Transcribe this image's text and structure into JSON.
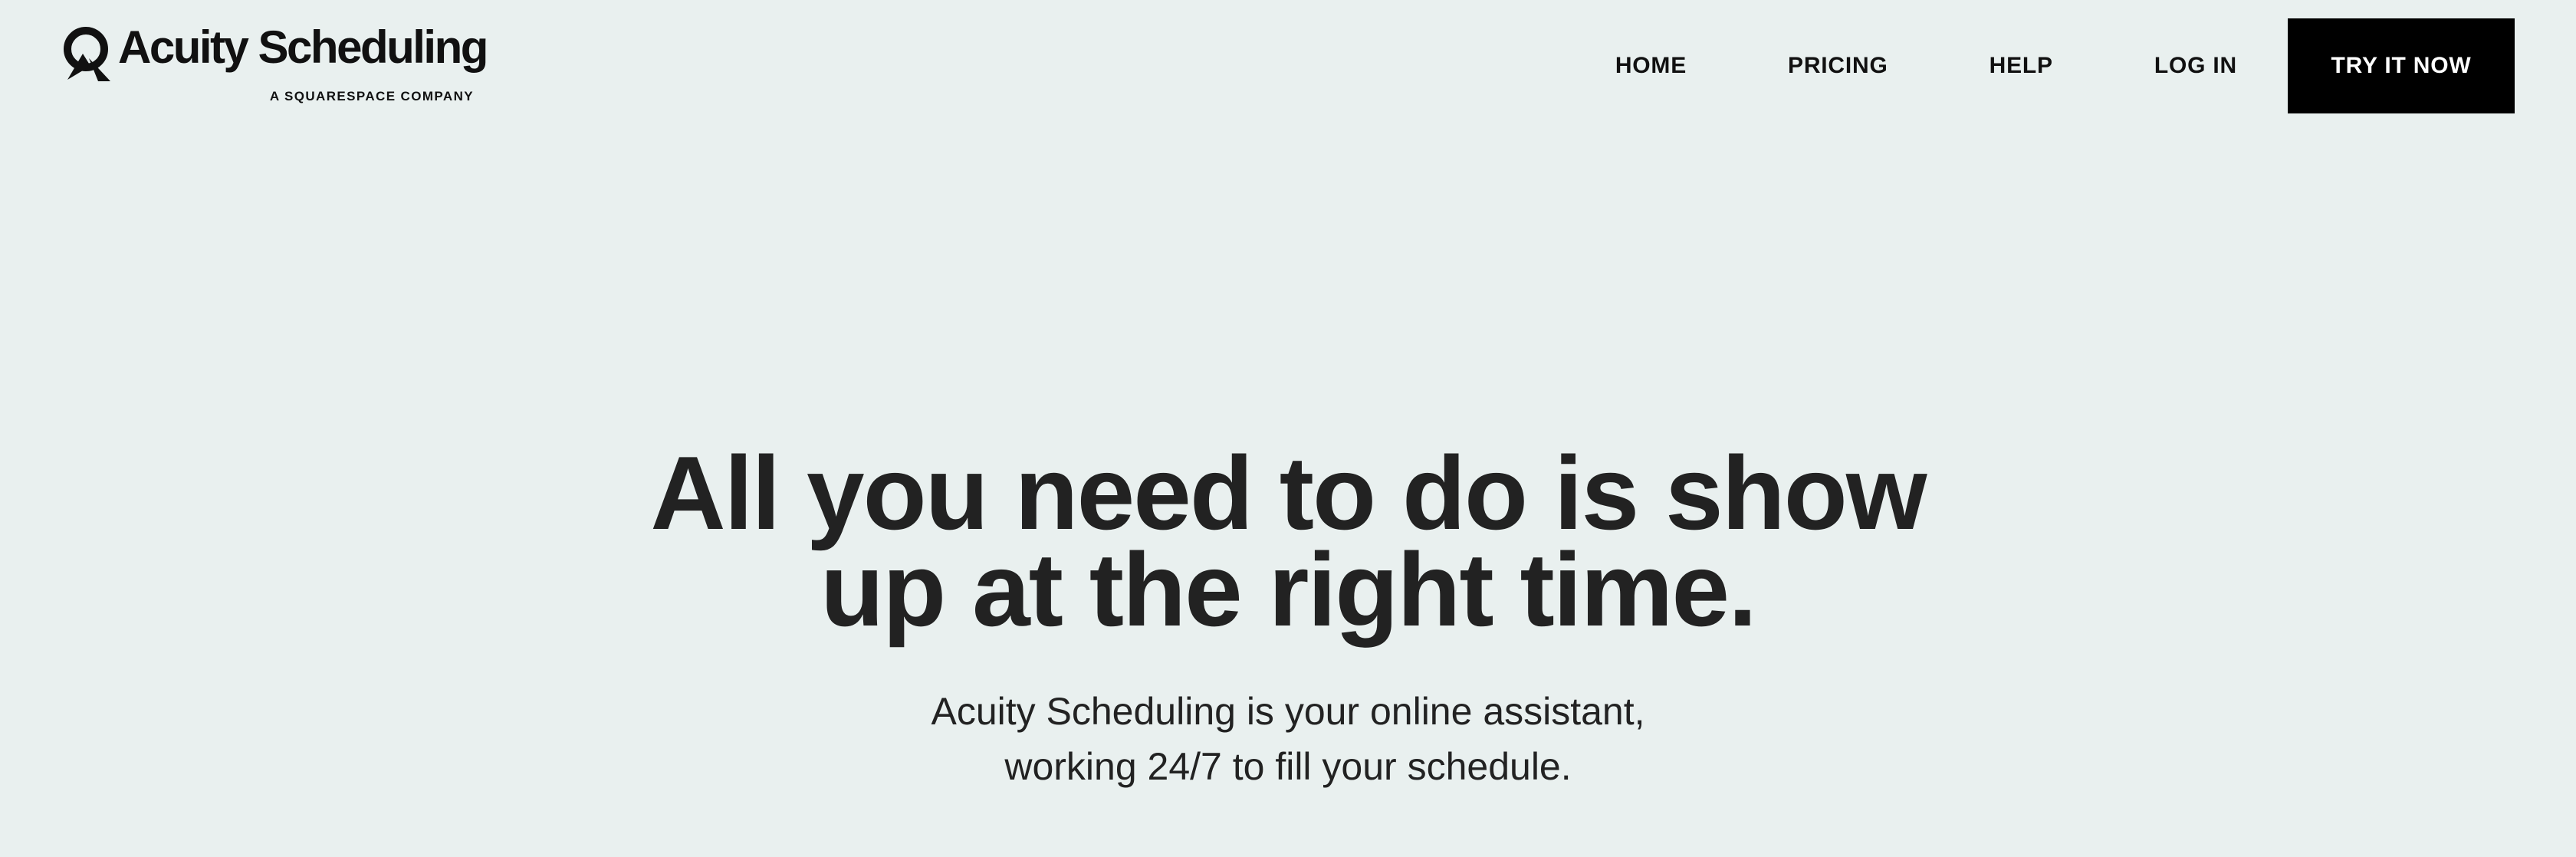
{
  "brand": {
    "name": "Acuity Scheduling",
    "tagline": "A SQUARESPACE COMPANY",
    "logo_icon": "acuity-logo-mark"
  },
  "nav": {
    "links": [
      {
        "label": "HOME"
      },
      {
        "label": "PRICING"
      },
      {
        "label": "HELP"
      },
      {
        "label": "LOG IN"
      }
    ],
    "cta_label": "TRY IT NOW"
  },
  "hero": {
    "title_lines": [
      "All you need to do is show",
      "up at the right time."
    ],
    "subtitle_lines": [
      "Acuity Scheduling is your online assistant,",
      "working 24/7 to fill your schedule."
    ]
  },
  "colors": {
    "background": "#e9f0ef",
    "text": "#222222",
    "cta_background": "#000000",
    "cta_text": "#ffffff"
  }
}
